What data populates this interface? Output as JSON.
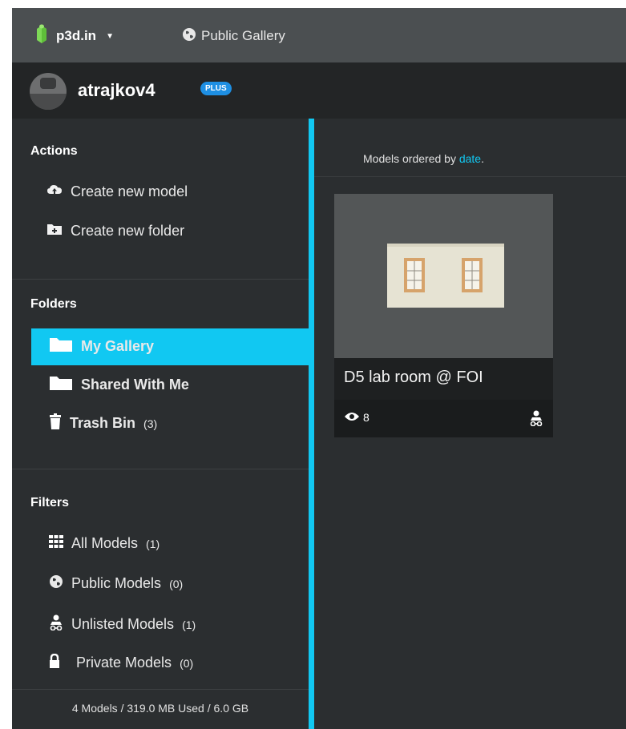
{
  "topbar": {
    "brand": "p3d.in",
    "nav_label": "Public Gallery"
  },
  "user": {
    "name": "atrajkov4",
    "badge": "PLUS"
  },
  "sidebar": {
    "actions_title": "Actions",
    "actions": [
      {
        "label": "Create new model",
        "icon": "cloud-upload-icon"
      },
      {
        "label": "Create new folder",
        "icon": "folder-plus-icon"
      }
    ],
    "folders_title": "Folders",
    "folders": [
      {
        "label": "My Gallery",
        "icon": "folder-icon",
        "active": true
      },
      {
        "label": "Shared With Me",
        "icon": "folder-icon"
      },
      {
        "label": "Trash Bin",
        "count": "(3)",
        "icon": "trash-icon"
      }
    ],
    "filters_title": "Filters",
    "filters": [
      {
        "label": "All Models",
        "count": "(1)",
        "icon": "grid-icon"
      },
      {
        "label": "Public Models",
        "count": "(0)",
        "icon": "globe-icon"
      },
      {
        "label": "Unlisted Models",
        "count": "(1)",
        "icon": "unlisted-icon"
      },
      {
        "label": "Private Models",
        "count": "(0)",
        "icon": "lock-icon"
      }
    ],
    "storage": "4 Models  /  319.0 MB Used  /  6.0 GB"
  },
  "content": {
    "order_prefix": "Models ordered by ",
    "order_link": "date",
    "order_suffix": ".",
    "models": [
      {
        "title": "D5 lab room @ FOI",
        "views": "8"
      }
    ]
  },
  "colors": {
    "accent": "#11c8f2",
    "topbar": "#4b4f51",
    "sidebar": "#2b2e30",
    "plus_badge": "#1e8fe3",
    "logo": "#7ed957"
  }
}
